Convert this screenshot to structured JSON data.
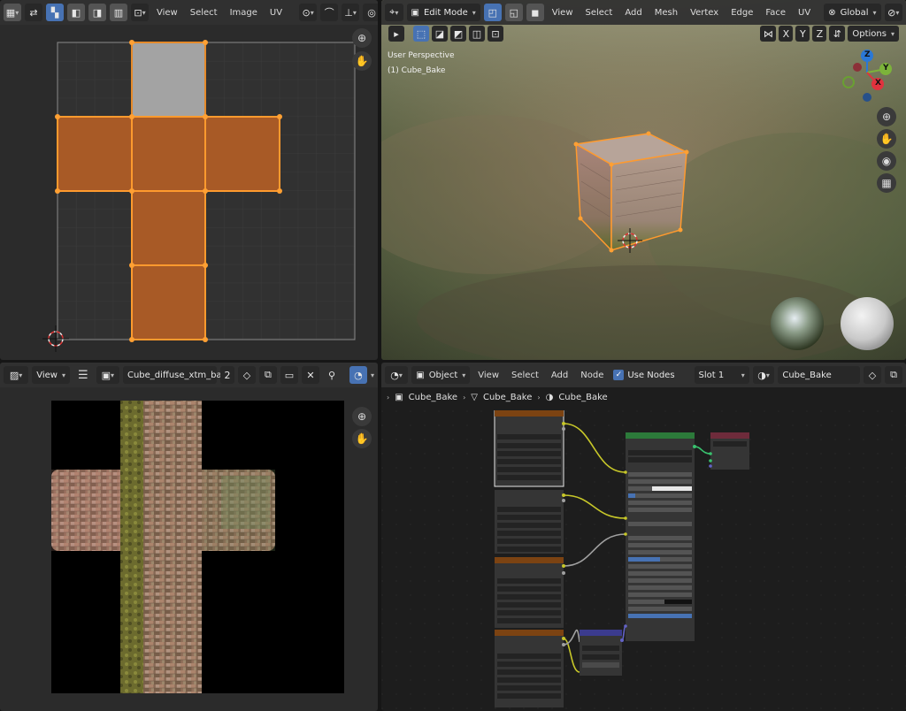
{
  "uv_editor": {
    "menus": [
      "View",
      "Select",
      "Image",
      "UV"
    ]
  },
  "viewport3d": {
    "mode": "Edit Mode",
    "menus": [
      "View",
      "Select",
      "Add",
      "Mesh",
      "Vertex",
      "Edge",
      "Face",
      "UV"
    ],
    "orientation": "Global",
    "axes": [
      "X",
      "Y",
      "Z"
    ],
    "options_label": "Options",
    "overlay_line1": "User Perspective",
    "overlay_line2": "(1) Cube_Bake",
    "gizmo": {
      "x": "X",
      "y": "Y",
      "z": "Z"
    }
  },
  "image_editor": {
    "view_label": "View",
    "image_name": "Cube_diffuse_xtm_bake",
    "users": "2"
  },
  "node_editor": {
    "object_label": "Object",
    "menus": [
      "View",
      "Select",
      "Add",
      "Node"
    ],
    "use_nodes_label": "Use Nodes",
    "slot": "Slot 1",
    "material": "Cube_Bake",
    "breadcrumbs": [
      "Cube_Bake",
      "Cube_Bake",
      "Cube_Bake"
    ]
  },
  "colors": {
    "accent": "#4772b3",
    "selection": "#ffa033",
    "face_select": "#b0602a",
    "node_texture_header": "#7c4312",
    "node_shader_header": "#2c7a3a",
    "node_output_header": "#6e2b3b",
    "node_vector_header": "#3b3b8e"
  },
  "icons": {
    "uv_editor": [
      "editor-type-icon",
      "sync-selection-icon",
      "vertex-select-icon",
      "edge-select-icon",
      "face-select-icon",
      "island-select-icon",
      "sticky-select-icon",
      "pivot-icon",
      "snap-icon",
      "proportional-icon",
      "zoom-icon",
      "hand-icon",
      "cursor-icon"
    ],
    "viewport3d": [
      "editor-type-icon",
      "vertex-select-icon",
      "edge-select-icon",
      "face-select-icon",
      "transform-orientation-icon",
      "pivot-icon",
      "snap-icon",
      "zoom-icon",
      "hand-icon",
      "camera-icon",
      "grid-icon"
    ],
    "image_editor": [
      "editor-type-icon",
      "hamburger-icon",
      "image-browse-icon",
      "fake-user-icon",
      "duplicate-icon",
      "folder-icon",
      "close-icon",
      "pin-icon",
      "overlay-icon"
    ],
    "node_editor": [
      "editor-type-icon",
      "object-icon",
      "checkbox-icon",
      "material-icon",
      "fake-user-icon"
    ]
  }
}
